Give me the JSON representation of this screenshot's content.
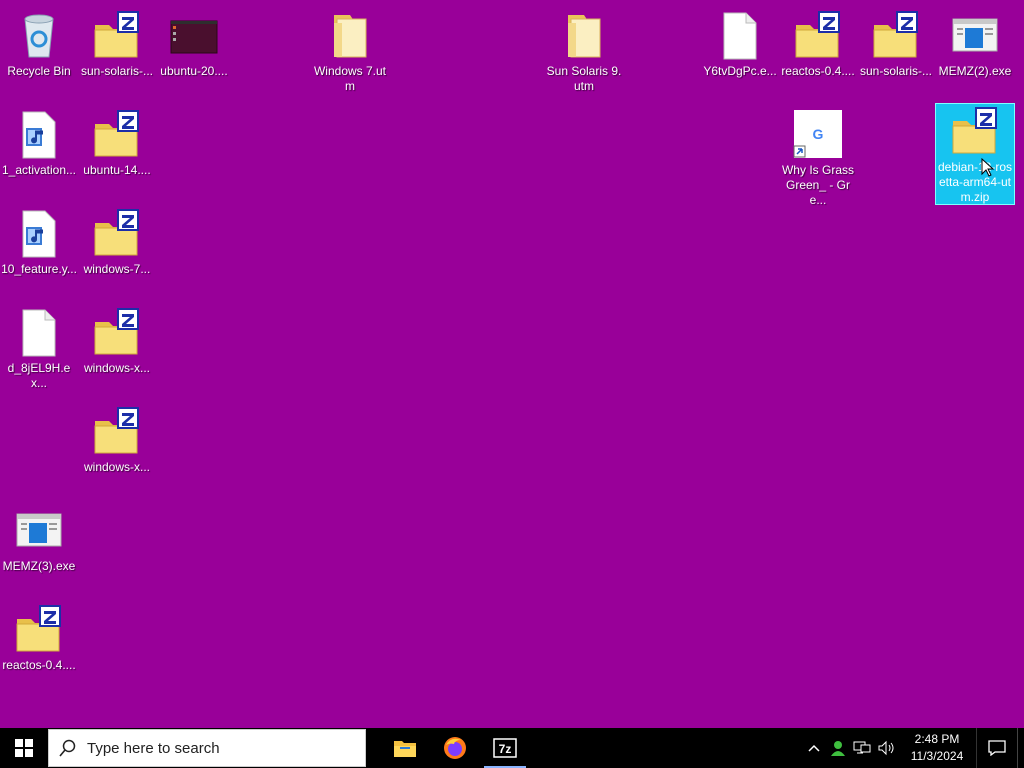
{
  "desktop": {
    "background_color": "#990099",
    "icons": {
      "recycle_bin": {
        "label": "Recycle Bin",
        "icon": "recycle-bin-icon"
      },
      "sun_solaris_1": {
        "label": "sun-solaris-...",
        "icon": "zip-folder-icon"
      },
      "ubuntu_20": {
        "label": "ubuntu-20....",
        "icon": "ubuntu-thumbnail-icon"
      },
      "windows7_utm": {
        "label": "Windows 7.utm",
        "icon": "folder-icon"
      },
      "sun_solaris_9": {
        "label": "Sun Solaris 9.utm",
        "icon": "folder-icon"
      },
      "y6tv": {
        "label": "Y6tvDgPc.e...",
        "icon": "blank-file-icon"
      },
      "reactos_top": {
        "label": "reactos-0.4....",
        "icon": "zip-folder-icon"
      },
      "sun_solaris_2": {
        "label": "sun-solaris-...",
        "icon": "zip-folder-icon"
      },
      "memz2": {
        "label": "MEMZ(2).exe",
        "icon": "app-window-icon"
      },
      "activation": {
        "label": "1_activation...",
        "icon": "media-file-icon"
      },
      "ubuntu_14": {
        "label": "ubuntu-14....",
        "icon": "zip-folder-icon"
      },
      "why_grass": {
        "label": "Why Is Grass Green_ - Gre...",
        "icon": "google-shortcut-icon"
      },
      "debian": {
        "label": "debian-12-rosetta-arm64-utm.zip",
        "icon": "zip-folder-icon"
      },
      "feature": {
        "label": "10_feature.y...",
        "icon": "media-file-icon"
      },
      "windows7_zip": {
        "label": "windows-7...",
        "icon": "zip-folder-icon"
      },
      "d8jel": {
        "label": "d_8jEL9H.ex...",
        "icon": "blank-file-icon"
      },
      "windows_x1": {
        "label": "windows-x...",
        "icon": "zip-folder-icon"
      },
      "windows_x2": {
        "label": "windows-x...",
        "icon": "zip-folder-icon"
      },
      "memz3": {
        "label": "MEMZ(3).exe",
        "icon": "app-window-icon"
      },
      "reactos_bottom": {
        "label": "reactos-0.4....",
        "icon": "zip-folder-icon"
      }
    }
  },
  "taskbar": {
    "search_placeholder": "Type here to search",
    "apps": [
      "file-explorer-icon",
      "firefox-icon",
      "7zip-icon"
    ],
    "clock_time": "2:48 PM",
    "clock_date": "11/3/2024"
  }
}
